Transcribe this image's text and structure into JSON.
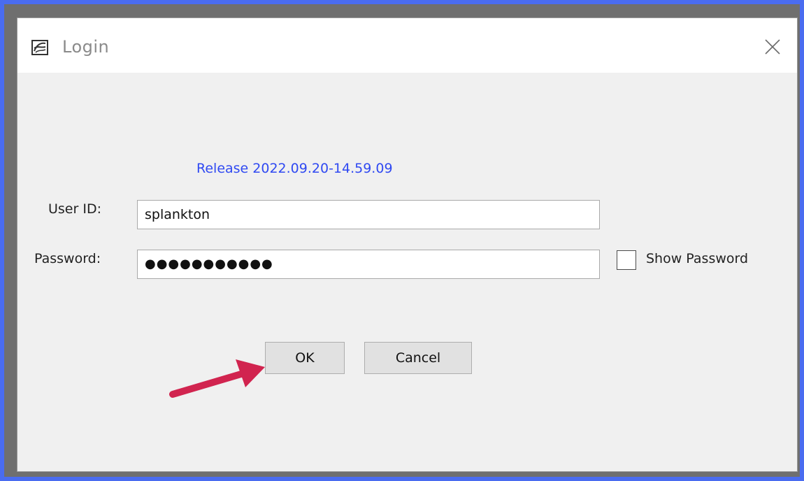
{
  "window": {
    "title": "Login",
    "app_icon": "app-logo-icon",
    "close_icon": "close-icon"
  },
  "release": "Release 2022.09.20-14.59.09",
  "form": {
    "user_id_label": "User ID:",
    "user_id_value": "splankton",
    "password_label": "Password:",
    "password_masked": "●●●●●●●●●●●",
    "show_password_label": "Show Password",
    "show_password_checked": false
  },
  "buttons": {
    "ok": "OK",
    "cancel": "Cancel"
  },
  "annotation": {
    "arrow_color": "#d1244f"
  }
}
